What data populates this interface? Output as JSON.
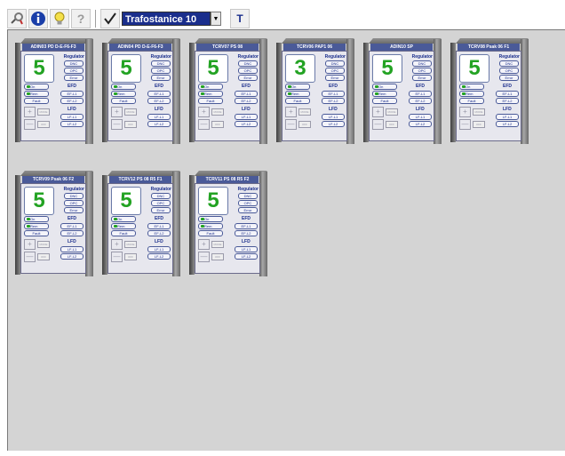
{
  "toolbar": {
    "station_select": "Trafostanice 10",
    "t_button": "T"
  },
  "devices": [
    {
      "title": "ADIN03 PD D-E-F6-F3",
      "digit": "5",
      "regulator": "Regulator",
      "dnc": "DNC",
      "opc": "OPC",
      "error": "Error",
      "on": "On",
      "rem": "Rem",
      "fault": "Fault",
      "efd": "EFD",
      "ef1": "EF-L1",
      "ef2": "EF-L2",
      "lfd": "LFD",
      "lf1": "LF-L1",
      "lf2": "LF-L2",
      "mode": "MODE",
      "off": "OFF"
    },
    {
      "title": "ADIN04 PD D-E-F6-F3",
      "digit": "5",
      "regulator": "Regulator",
      "dnc": "DNC",
      "opc": "OPC",
      "error": "Error",
      "on": "On",
      "rem": "Rem",
      "fault": "Fault",
      "efd": "EFD",
      "ef1": "EF-L1",
      "ef2": "EF-L2",
      "lfd": "LFD",
      "lf1": "LF-L1",
      "lf2": "LF-L2",
      "mode": "MODE",
      "off": "OFF"
    },
    {
      "title": "TCRV07 PS 08",
      "digit": "5",
      "regulator": "Regulator",
      "dnc": "DNC",
      "opc": "OPC",
      "error": "Error",
      "on": "On",
      "rem": "Rem",
      "fault": "Fault",
      "efd": "EFD",
      "ef1": "EF-L1",
      "ef2": "EF-L2",
      "lfd": "LFD",
      "lf1": "LF-L1",
      "lf2": "LF-L2",
      "mode": "MODE",
      "off": "OFF"
    },
    {
      "title": "TCRV06 PAP1 06",
      "digit": "3",
      "regulator": "Regulator",
      "dnc": "DNC",
      "opc": "OPC",
      "error": "Error",
      "on": "On",
      "rem": "Rem",
      "fault": "Fault",
      "efd": "EFD",
      "ef1": "EF-L1",
      "ef2": "EF-L2",
      "lfd": "LFD",
      "lf1": "LF-L1",
      "lf2": "LF-L2",
      "mode": "MODE",
      "off": "OFF"
    },
    {
      "title": "ADIN10 SP",
      "digit": "5",
      "regulator": "Regulator",
      "dnc": "DNC",
      "opc": "OPC",
      "error": "Error",
      "on": "On",
      "rem": "Rem",
      "fault": "Fault",
      "efd": "EFD",
      "ef1": "EF-L1",
      "ef2": "EF-L2",
      "lfd": "LFD",
      "lf1": "LF-L1",
      "lf2": "LF-L2",
      "mode": "MODE",
      "off": "OFF"
    },
    {
      "title": "TCRV08 Psak 06 F1",
      "digit": "5",
      "regulator": "Regulator",
      "dnc": "DNC",
      "opc": "OPC",
      "error": "Error",
      "on": "On",
      "rem": "Rem",
      "fault": "Fault",
      "efd": "EFD",
      "ef1": "EF-L1",
      "ef2": "EF-L2",
      "lfd": "LFD",
      "lf1": "LF-L1",
      "lf2": "LF-L2",
      "mode": "MODE",
      "off": "OFF"
    },
    {
      "title": "TCRV09 Psak 06 F2",
      "digit": "5",
      "regulator": "Regulator",
      "dnc": "DNC",
      "opc": "OPC",
      "error": "Error",
      "on": "On",
      "rem": "Rem",
      "fault": "Fault",
      "efd": "EFD",
      "ef1": "EF-L1",
      "ef2": "EF-L2",
      "lfd": "LFD",
      "lf1": "LF-L1",
      "lf2": "LF-L2",
      "mode": "MODE",
      "off": "OFF"
    },
    {
      "title": "TCRV12 PS 08 R5 F1",
      "digit": "5",
      "regulator": "Regulator",
      "dnc": "DNC",
      "opc": "OPC",
      "error": "Error",
      "on": "On",
      "rem": "Rem",
      "fault": "Fault",
      "efd": "EFD",
      "ef1": "EF-L1",
      "ef2": "EF-L2",
      "lfd": "LFD",
      "lf1": "LF-L1",
      "lf2": "LF-L2",
      "mode": "MODE",
      "off": "OFF"
    },
    {
      "title": "TCRV11 PS 08 R5 F2",
      "digit": "5",
      "regulator": "Regulator",
      "dnc": "DNC",
      "opc": "OPC",
      "error": "Error",
      "on": "On",
      "rem": "Rem",
      "fault": "Fault",
      "efd": "EFD",
      "ef1": "EF-L1",
      "ef2": "EF-L2",
      "lfd": "LFD",
      "lf1": "LF-L1",
      "lf2": "LF-L2",
      "mode": "MODE",
      "off": "OFF"
    }
  ]
}
